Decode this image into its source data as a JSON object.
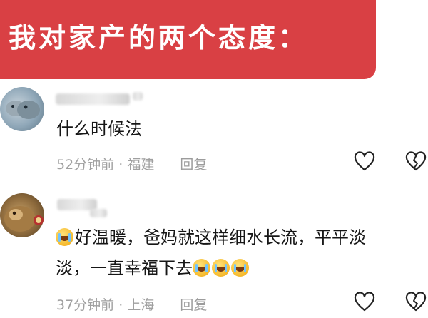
{
  "banner": {
    "title": "我对家产的两个态度：",
    "color": "#d94044"
  },
  "comments": [
    {
      "text": "什么时候法",
      "time": "52分钟前",
      "separator": "·",
      "location": "福建",
      "reply_label": "回复"
    },
    {
      "text_line1": "好温暖，爸妈就这样细水长流，平平淡",
      "text_line2": "淡，一直幸福下去",
      "time": "37分钟前",
      "separator": "·",
      "location": "上海",
      "reply_label": "回复"
    }
  ],
  "icons": {
    "like": "heart-outline-icon",
    "dislike": "broken-heart-icon",
    "emoji": "crying-face-emoji"
  }
}
